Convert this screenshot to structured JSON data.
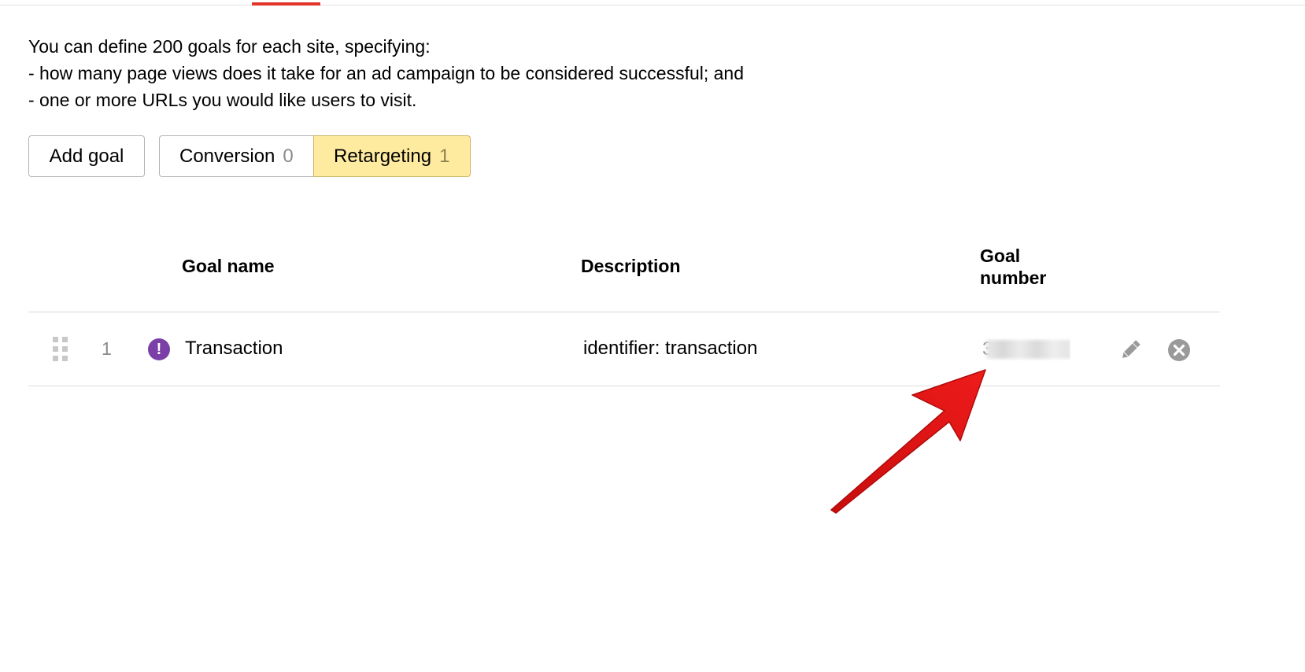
{
  "intro": {
    "line1": "You can define 200 goals for each site, specifying:",
    "line2": "-  how many page views does it take for an ad campaign to be considered successful; and",
    "line3": "-  one or more URLs you would like users to visit."
  },
  "toolbar": {
    "add_goal_label": "Add goal",
    "filters": [
      {
        "label": "Conversion",
        "count": "0",
        "selected": false
      },
      {
        "label": "Retargeting",
        "count": "1",
        "selected": true
      }
    ]
  },
  "table": {
    "headers": {
      "name": "Goal name",
      "description": "Description",
      "number_line1": "Goal",
      "number_line2": "number"
    },
    "rows": [
      {
        "index": "1",
        "status_icon": "exclamation-icon",
        "name": "Transaction",
        "description": "identifier: transaction",
        "number_visible": "3"
      }
    ]
  },
  "colors": {
    "accent": "#e3342a",
    "selected_filter": "#ffeba0",
    "status_icon": "#7b3fa8",
    "annotation_arrow": "#e01515"
  }
}
